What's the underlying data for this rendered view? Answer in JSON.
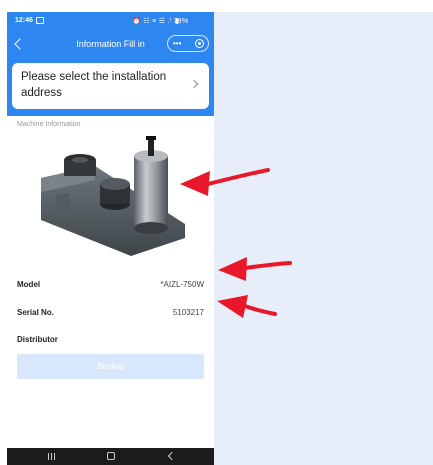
{
  "status_bar": {
    "time": "12:46",
    "icons": "⏰ ☷ ≡ ☰ .ᴵ 79%",
    "battery": "▮"
  },
  "header": {
    "title": "Information Fill in",
    "capsule_more": "•••"
  },
  "address": {
    "placeholder": "Please select the installation address"
  },
  "machine": {
    "section_title": "Machine Information",
    "model_label": "Model",
    "model_value": "*AIZL-750W",
    "serial_label": "Serial No.",
    "serial_value": "5103217",
    "distributor_label": "Distributor",
    "distributor_value": ""
  },
  "binding_button": "Binding",
  "colors": {
    "primary_blue": "#2e86f0",
    "arrow_red": "#e8182a",
    "button_disabled": "#d8e7fb",
    "right_panel": "#e8eef9"
  },
  "icons": [
    "back-icon",
    "more-icon",
    "target-icon",
    "chevron-right-icon",
    "recent-apps-icon",
    "home-icon",
    "nav-back-icon",
    "arrow-annotation"
  ]
}
